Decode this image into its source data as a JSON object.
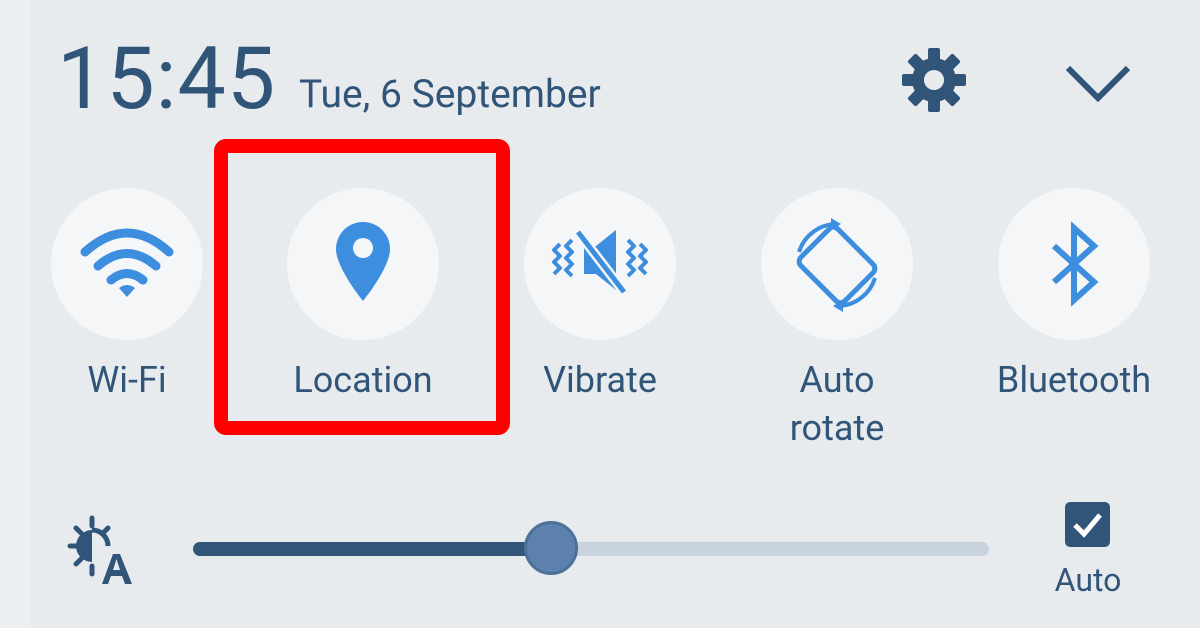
{
  "status": {
    "time": "15:45",
    "date": "Tue, 6 September"
  },
  "header": {
    "settings_icon": "gear-icon",
    "collapse_icon": "chevron-down-icon"
  },
  "quick_settings": {
    "tiles": [
      {
        "label": "Wi-Fi",
        "icon": "wifi-icon",
        "active": true
      },
      {
        "label": "Location",
        "icon": "location-pin-icon",
        "active": true,
        "highlighted": true
      },
      {
        "label": "Vibrate",
        "icon": "vibrate-icon",
        "active": true
      },
      {
        "label": "Auto\nrotate",
        "icon": "auto-rotate-icon",
        "active": true
      },
      {
        "label": "Bluetooth",
        "icon": "bluetooth-icon",
        "active": true
      }
    ]
  },
  "brightness": {
    "icon": "brightness-auto-icon",
    "level": 0.45,
    "auto_label": "Auto",
    "auto_checked": true
  },
  "colors": {
    "background": "#e8ebee",
    "tile_background": "#f5f6f8",
    "icon_blue": "#3d8ede",
    "text": "#315579",
    "highlight": "#ff0000",
    "slider_track": "#c9d3de",
    "slider_thumb": "#5b81ac"
  }
}
